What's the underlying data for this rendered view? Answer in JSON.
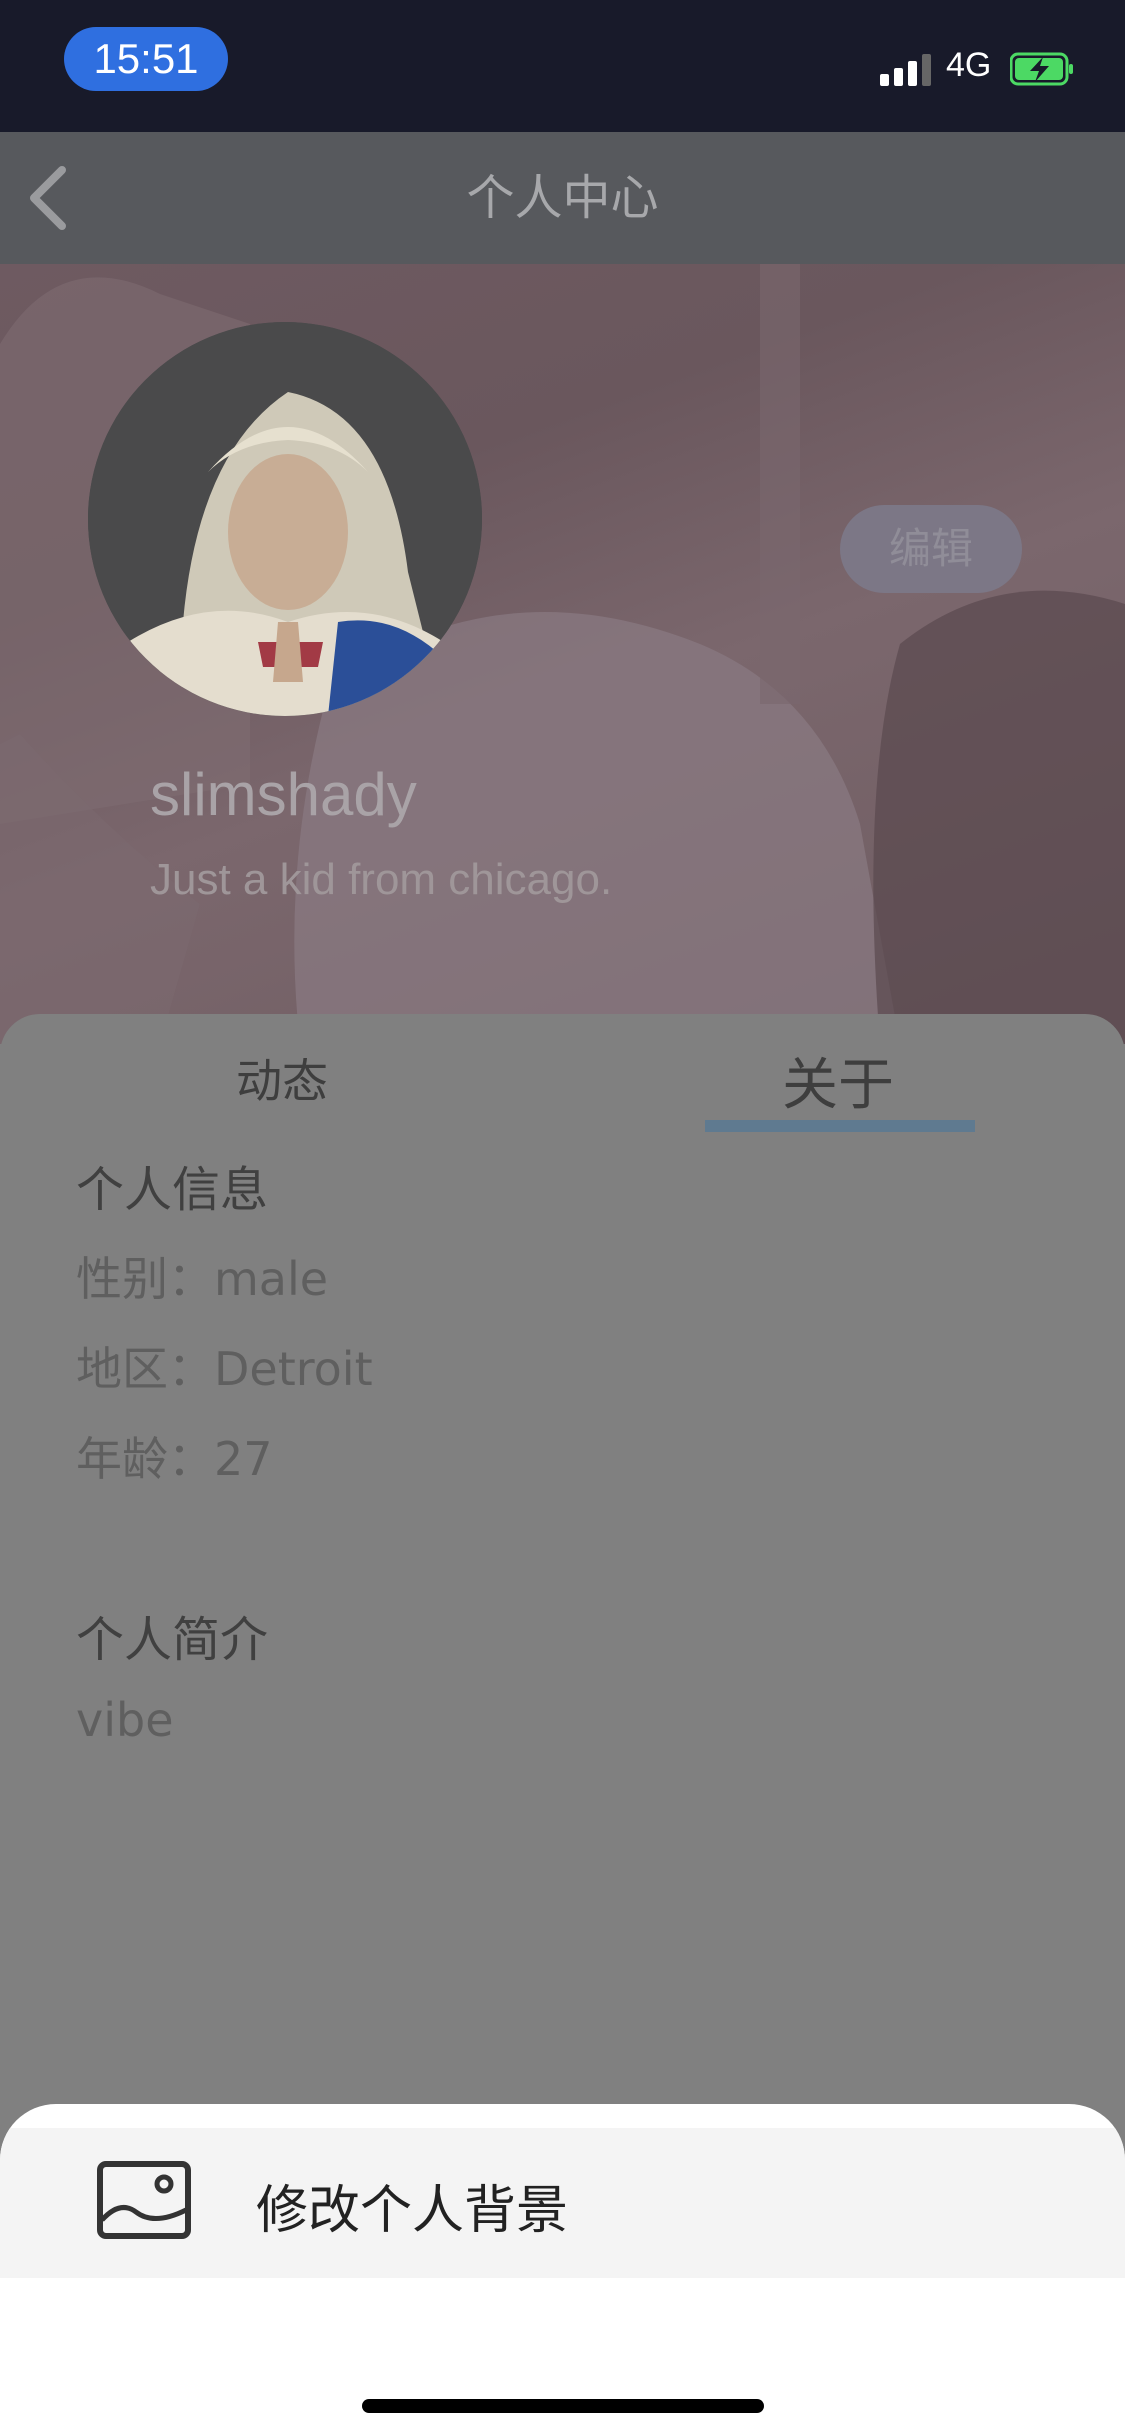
{
  "status_bar": {
    "time": "15:51",
    "network": "4G"
  },
  "nav": {
    "title": "个人中心",
    "back_icon": "chevron-left-icon"
  },
  "profile": {
    "username": "slimshady",
    "bio": "Just a kid from chicago.",
    "edit_label": "编辑"
  },
  "tabs": [
    {
      "label": "动态",
      "active": false
    },
    {
      "label": "关于",
      "active": true
    }
  ],
  "about": {
    "info_heading": "个人信息",
    "gender": "性别：male",
    "region": "地区：Detroit",
    "age": "年龄：27",
    "intro_heading": "个人简介",
    "intro": "vibe"
  },
  "action_sheet": {
    "items": [
      {
        "label": "修改个人背景",
        "icon": "image-icon"
      }
    ]
  },
  "colors": {
    "accent": "#2f6fe0",
    "tab_indicator": "#5f7a90",
    "battery": "#4cd964"
  }
}
